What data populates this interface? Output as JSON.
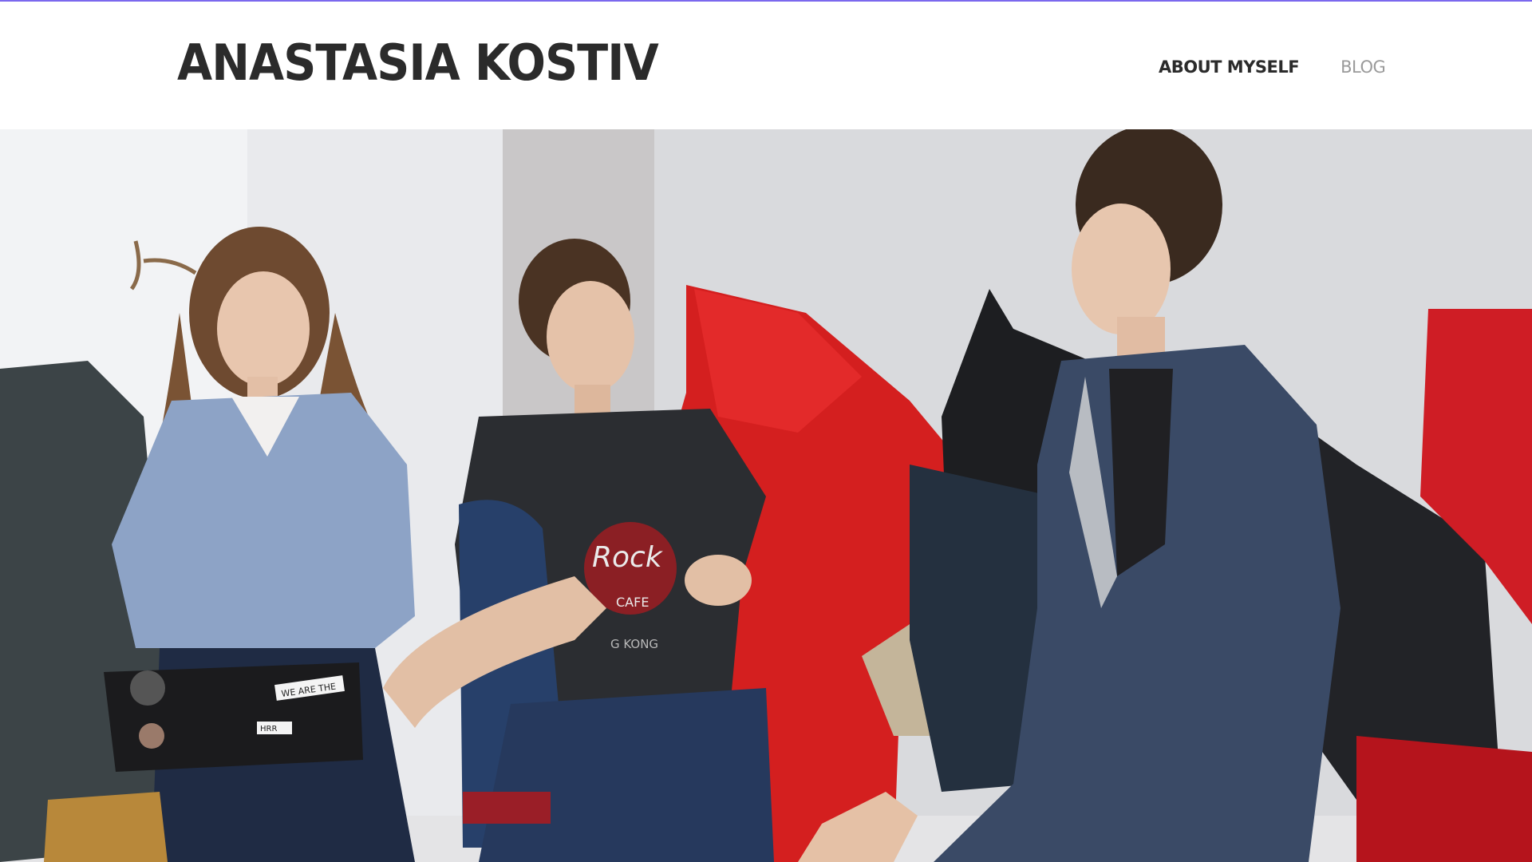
{
  "header": {
    "site_title": "ANASTASIA KOSTIV",
    "nav": [
      {
        "label": "ABOUT MYSELF",
        "active": true
      },
      {
        "label": "BLOG",
        "active": false
      }
    ]
  },
  "hero": {
    "image_alt": "Three young people sitting on bean bags and talking",
    "laptop_stickers": [
      "WE ARE THE",
      "HRR"
    ],
    "shirt_print": [
      "Rock",
      "CAFE",
      "G KONG"
    ]
  },
  "colors": {
    "accent_rule": "#7b68ee",
    "title": "#2b2b2b",
    "nav_active": "#2b2b2b",
    "nav_inactive": "#9a9a9a"
  }
}
